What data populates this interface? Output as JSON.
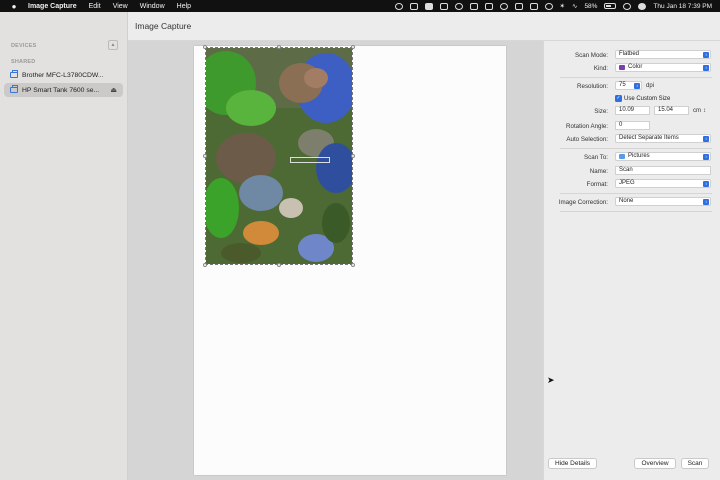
{
  "menubar": {
    "app_name": "Image Capture",
    "menus": [
      "Edit",
      "View",
      "Window",
      "Help"
    ],
    "battery": "58%",
    "datetime": "Thu Jan 18  7:39 PM"
  },
  "sidebar": {
    "devices_label": "DEVICES",
    "shared_label": "SHARED",
    "items": [
      {
        "label": "Brother MFC-L3780CDW..."
      },
      {
        "label": "HP Smart Tank 7600 se..."
      }
    ]
  },
  "window": {
    "title": "Image Capture"
  },
  "settings": {
    "scan_mode": {
      "label": "Scan Mode:",
      "value": "Flatbed"
    },
    "kind": {
      "label": "Kind:",
      "value": "Color",
      "swatch_color": "#7b3fb0"
    },
    "resolution": {
      "label": "Resolution:",
      "value": "75",
      "unit": "dpi"
    },
    "custom_size": {
      "label": "Use Custom Size",
      "checked": true
    },
    "size": {
      "label": "Size:",
      "width": "10.09",
      "height": "15.04",
      "unit": "cm"
    },
    "rotation": {
      "label": "Rotation Angle:",
      "value": "0"
    },
    "auto_selection": {
      "label": "Auto Selection:",
      "value": "Detect Separate Items"
    },
    "scan_to": {
      "label": "Scan To:",
      "value": "Pictures"
    },
    "name": {
      "label": "Name:",
      "value": "Scan"
    },
    "format": {
      "label": "Format:",
      "value": "JPEG"
    },
    "image_correction": {
      "label": "Image Correction:",
      "value": "None"
    }
  },
  "buttons": {
    "hide_details": "Hide Details",
    "overview": "Overview",
    "scan": "Scan"
  },
  "colors": {
    "accent": "#2f6fe0"
  }
}
